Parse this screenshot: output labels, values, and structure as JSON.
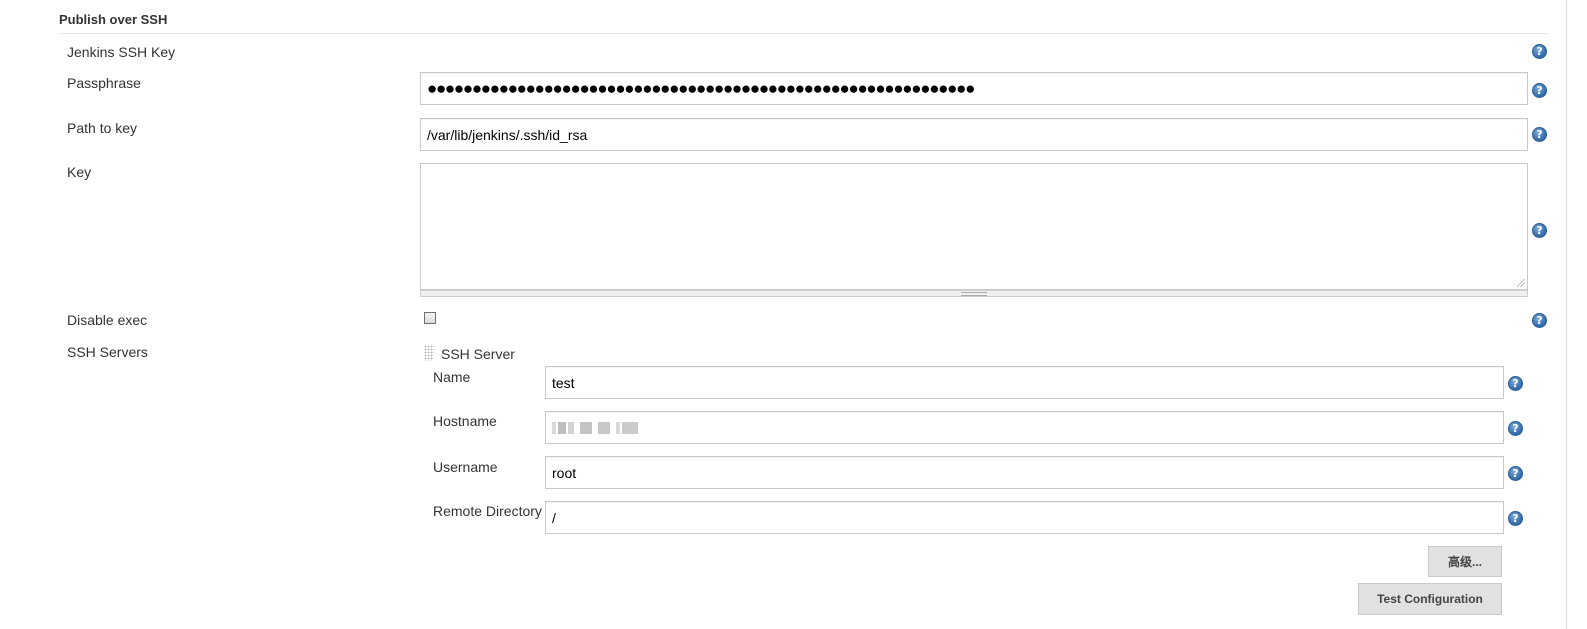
{
  "section": {
    "title": "Publish over SSH"
  },
  "fields": {
    "jenkins_ssh_key_label": "Jenkins SSH Key",
    "passphrase_label": "Passphrase",
    "passphrase_value": "●●●●●●●●●●●●●●●●●●●●●●●●●●●●●●●●●●●●●●●●●●●●●●●●●●●●●●●●●●●●●",
    "path_to_key_label": "Path to key",
    "path_to_key_value": "/var/lib/jenkins/.ssh/id_rsa",
    "key_label": "Key",
    "key_value": "",
    "disable_exec_label": "Disable exec",
    "disable_exec_checked": false,
    "ssh_servers_label": "SSH Servers"
  },
  "ssh_server": {
    "title": "SSH Server",
    "name_label": "Name",
    "name_value": "test",
    "hostname_label": "Hostname",
    "username_label": "Username",
    "username_value": "root",
    "remote_directory_label": "Remote Directory",
    "remote_directory_value": "/"
  },
  "buttons": {
    "advanced_label": "高级...",
    "test_configuration_label": "Test Configuration"
  },
  "icons": {
    "help": "help-icon",
    "drag_handle": "drag-handle-icon",
    "resize": "resize-grip-icon"
  },
  "colors": {
    "help_icon": "#2f6aa8",
    "button_bg": "#e1e1e1",
    "input_border": "#c8c8c8"
  }
}
